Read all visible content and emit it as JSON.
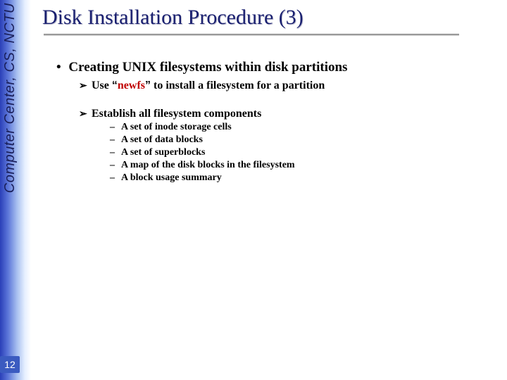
{
  "sidebar": {
    "label": "Computer Center, CS, NCTU"
  },
  "page_number": "12",
  "title": "Disk Installation Procedure (3)",
  "bullet": {
    "main": "Creating UNIX filesystems within disk partitions",
    "sub1_pre": "Use ",
    "sub1_quote_open": "“",
    "sub1_keyword": "newfs",
    "sub1_quote_close": "”",
    "sub1_post": " to install a filesystem for a partition",
    "sub2": "Establish all filesystem components",
    "dashes": {
      "d1": "A set of inode storage cells",
      "d2": "A set of data blocks",
      "d3": "A set of superblocks",
      "d4": "A map of the disk blocks in the filesystem",
      "d5": "A block usage summary"
    }
  }
}
